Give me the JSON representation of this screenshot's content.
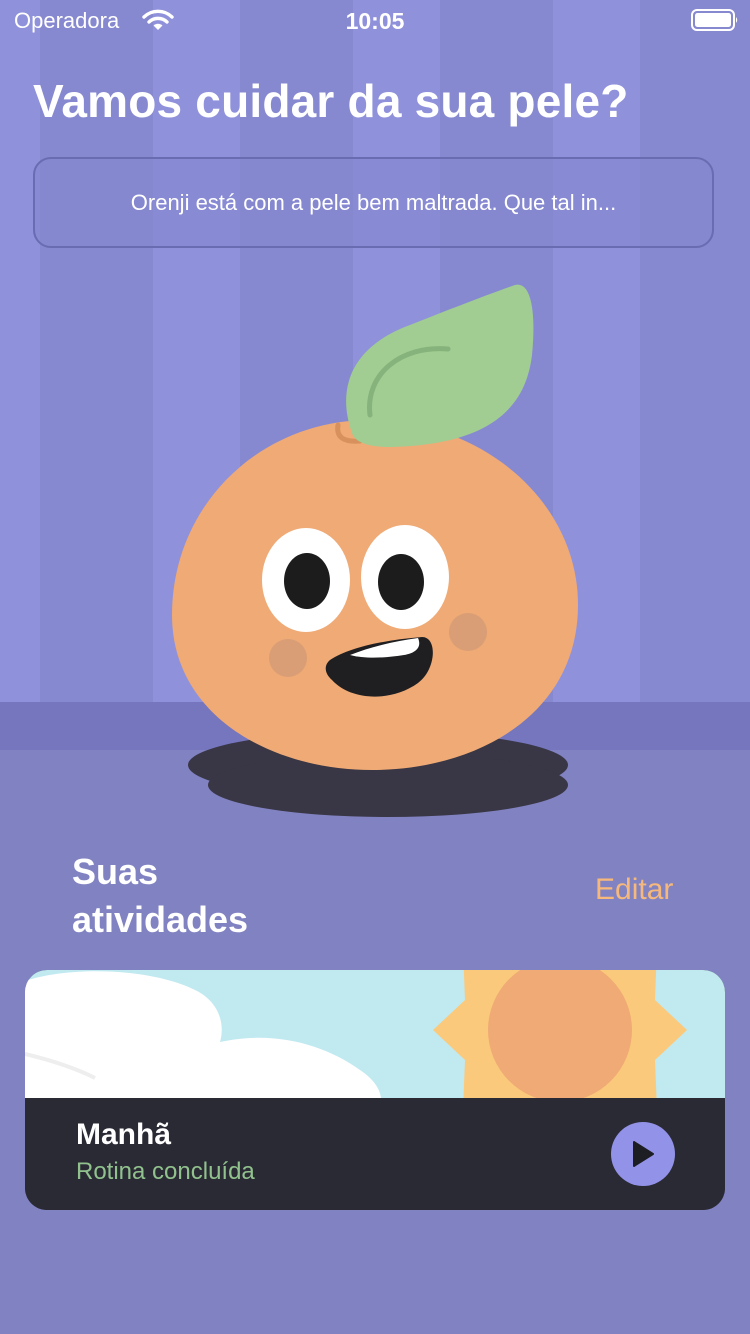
{
  "status_bar": {
    "carrier": "Operadora",
    "time": "10:05"
  },
  "header": {
    "title": "Vamos cuidar da sua pele?",
    "message": "Orenji está com a pele bem maltrada. Que tal in..."
  },
  "activities": {
    "title": "Suas atividades",
    "edit_label": "Editar",
    "routines": [
      {
        "name": "Manhã",
        "status": "Rotina concluída",
        "icon": "sun-icon"
      }
    ]
  },
  "colors": {
    "background": "#8182c1",
    "accent": "#f6b97b",
    "status_done": "#91c28d",
    "card_dark": "#2a2a35",
    "play_button": "#9293e8",
    "orange_body": "#efaa75",
    "leaf": "#a1cd92"
  }
}
